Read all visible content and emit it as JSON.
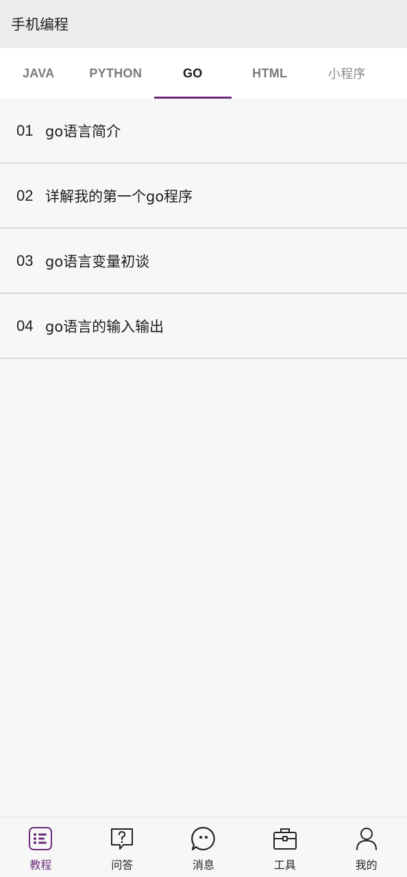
{
  "header": {
    "title": "手机编程"
  },
  "tabs": [
    {
      "label": "JAVA"
    },
    {
      "label": "PYTHON"
    },
    {
      "label": "GO"
    },
    {
      "label": "HTML"
    },
    {
      "label": "小程序"
    }
  ],
  "active_tab": "GO",
  "lessons": [
    {
      "num": "01",
      "title": "go语言简介"
    },
    {
      "num": "02",
      "title": "详解我的第一个go程序"
    },
    {
      "num": "03",
      "title": "go语言变量初谈"
    },
    {
      "num": "04",
      "title": "go语言的输入输出"
    }
  ],
  "bottom_nav": [
    {
      "label": "教程",
      "icon": "list-icon"
    },
    {
      "label": "问答",
      "icon": "question-icon"
    },
    {
      "label": "消息",
      "icon": "chat-icon"
    },
    {
      "label": "工具",
      "icon": "toolbox-icon"
    },
    {
      "label": "我的",
      "icon": "person-icon"
    }
  ],
  "active_nav": "教程",
  "colors": {
    "accent": "#6a2c7a",
    "background": "#f7f7f7",
    "header": "#ececec"
  }
}
